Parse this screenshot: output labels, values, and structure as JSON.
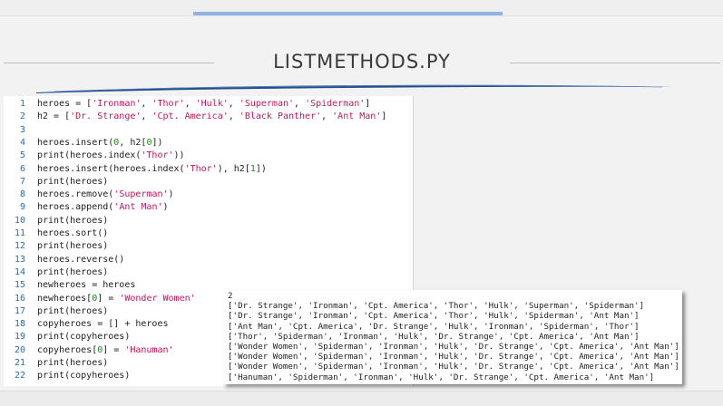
{
  "slide": {
    "title": "LISTMETHODS.PY",
    "colors": {
      "accent_bar": "#8fb4e3",
      "swoosh": "#1f4e8c",
      "line_number": "#2b6cb0",
      "string_literal": "#c2185b",
      "number_literal": "#1b8a1b"
    }
  },
  "code": {
    "lines": [
      {
        "n": "1",
        "html": "heroes = [<span class='str'>'Ironman'</span>, <span class='str'>'Thor'</span>, <span class='str'>'Hulk'</span>, <span class='str'>'Superman'</span>, <span class='str'>'Spiderman'</span>]"
      },
      {
        "n": "2",
        "html": "h2 = [<span class='str'>'Dr. Strange'</span>, <span class='str'>'Cpt. America'</span>, <span class='str'>'Black Panther'</span>, <span class='str'>'Ant Man'</span>]"
      },
      {
        "n": "3",
        "html": ""
      },
      {
        "n": "4",
        "html": "heroes.insert(<span class='num'>0</span>, h2[<span class='num'>0</span>])"
      },
      {
        "n": "5",
        "html": "print(heroes.index(<span class='str'>'Thor'</span>))"
      },
      {
        "n": "6",
        "html": "heroes.insert(heroes.index(<span class='str'>'Thor'</span>), h2[<span class='num'>1</span>])"
      },
      {
        "n": "7",
        "html": "print(heroes)"
      },
      {
        "n": "8",
        "html": "heroes.remove(<span class='str'>'Superman'</span>)"
      },
      {
        "n": "9",
        "html": "heroes.append(<span class='str'>'Ant Man'</span>)"
      },
      {
        "n": "10",
        "html": "print(heroes)"
      },
      {
        "n": "11",
        "html": "heroes.sort()"
      },
      {
        "n": "12",
        "html": "print(heroes)"
      },
      {
        "n": "13",
        "html": "heroes.reverse()"
      },
      {
        "n": "14",
        "html": "print(heroes)"
      },
      {
        "n": "15",
        "html": "newheroes = heroes"
      },
      {
        "n": "16",
        "html": "newheroes[<span class='num'>0</span>] = <span class='str'>'Wonder Women'</span>"
      },
      {
        "n": "17",
        "html": "print(heroes)"
      },
      {
        "n": "18",
        "html": "copyheroes = [] + heroes"
      },
      {
        "n": "19",
        "html": "print(copyheroes)"
      },
      {
        "n": "20",
        "html": "copyheroes[<span class='num'>0</span>] = <span class='str'>'Hanuman'</span>"
      },
      {
        "n": "21",
        "html": "print(heroes)"
      },
      {
        "n": "22",
        "html": "print(copyheroes)"
      }
    ]
  },
  "output": {
    "lines": [
      "2",
      "['Dr. Strange', 'Ironman', 'Cpt. America', 'Thor', 'Hulk', 'Superman', 'Spiderman']",
      "['Dr. Strange', 'Ironman', 'Cpt. America', 'Thor', 'Hulk', 'Spiderman', 'Ant Man']",
      "['Ant Man', 'Cpt. America', 'Dr. Strange', 'Hulk', 'Ironman', 'Spiderman', 'Thor']",
      "['Thor', 'Spiderman', 'Ironman', 'Hulk', 'Dr. Strange', 'Cpt. America', 'Ant Man']",
      "['Wonder Women', 'Spiderman', 'Ironman', 'Hulk', 'Dr. Strange', 'Cpt. America', 'Ant Man']",
      "['Wonder Women', 'Spiderman', 'Ironman', 'Hulk', 'Dr. Strange', 'Cpt. America', 'Ant Man']",
      "['Wonder Women', 'Spiderman', 'Ironman', 'Hulk', 'Dr. Strange', 'Cpt. America', 'Ant Man']",
      "['Hanuman', 'Spiderman', 'Ironman', 'Hulk', 'Dr. Strange', 'Cpt. America', 'Ant Man']"
    ]
  }
}
